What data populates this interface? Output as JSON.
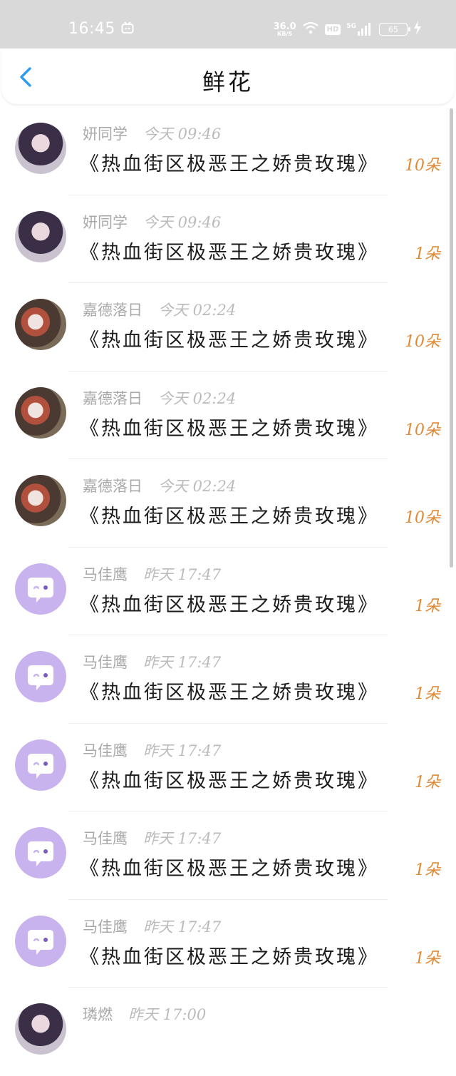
{
  "status_bar": {
    "time": "16:45",
    "net_speed_value": "36.0",
    "net_speed_unit": "KB/S",
    "hd_label": "HD",
    "signal_label": "5G",
    "battery": "65"
  },
  "header": {
    "title": "鲜花",
    "back_icon": "chevron-left-icon",
    "accent_color": "#2e9bef"
  },
  "items": [
    {
      "avatar": "girl",
      "name": "妍同学",
      "time": "今天 09:46",
      "book": "《热血街区极恶王之娇贵玫瑰》",
      "count": "10朵"
    },
    {
      "avatar": "girl",
      "name": "妍同学",
      "time": "今天 09:46",
      "book": "《热血街区极恶王之娇贵玫瑰》",
      "count": "1朵"
    },
    {
      "avatar": "art",
      "name": "嘉德落日",
      "time": "今天 02:24",
      "book": "《热血街区极恶王之娇贵玫瑰》",
      "count": "10朵"
    },
    {
      "avatar": "art",
      "name": "嘉德落日",
      "time": "今天 02:24",
      "book": "《热血街区极恶王之娇贵玫瑰》",
      "count": "10朵"
    },
    {
      "avatar": "art",
      "name": "嘉德落日",
      "time": "今天 02:24",
      "book": "《热血街区极恶王之娇贵玫瑰》",
      "count": "10朵"
    },
    {
      "avatar": "bot",
      "name": "马佳鹰",
      "time": "昨天 17:47",
      "book": "《热血街区极恶王之娇贵玫瑰》",
      "count": "1朵"
    },
    {
      "avatar": "bot",
      "name": "马佳鹰",
      "time": "昨天 17:47",
      "book": "《热血街区极恶王之娇贵玫瑰》",
      "count": "1朵"
    },
    {
      "avatar": "bot",
      "name": "马佳鹰",
      "time": "昨天 17:47",
      "book": "《热血街区极恶王之娇贵玫瑰》",
      "count": "1朵"
    },
    {
      "avatar": "bot",
      "name": "马佳鹰",
      "time": "昨天 17:47",
      "book": "《热血街区极恶王之娇贵玫瑰》",
      "count": "1朵"
    },
    {
      "avatar": "bot",
      "name": "马佳鹰",
      "time": "昨天 17:47",
      "book": "《热血街区极恶王之娇贵玫瑰》",
      "count": "1朵"
    },
    {
      "avatar": "girl",
      "name": "璘燃",
      "time": "昨天 17:00",
      "book": "",
      "count": ""
    }
  ],
  "colors": {
    "count": "#e08a38",
    "meta": "#a9a9a9",
    "bot_avatar": "#c9b3ee"
  }
}
